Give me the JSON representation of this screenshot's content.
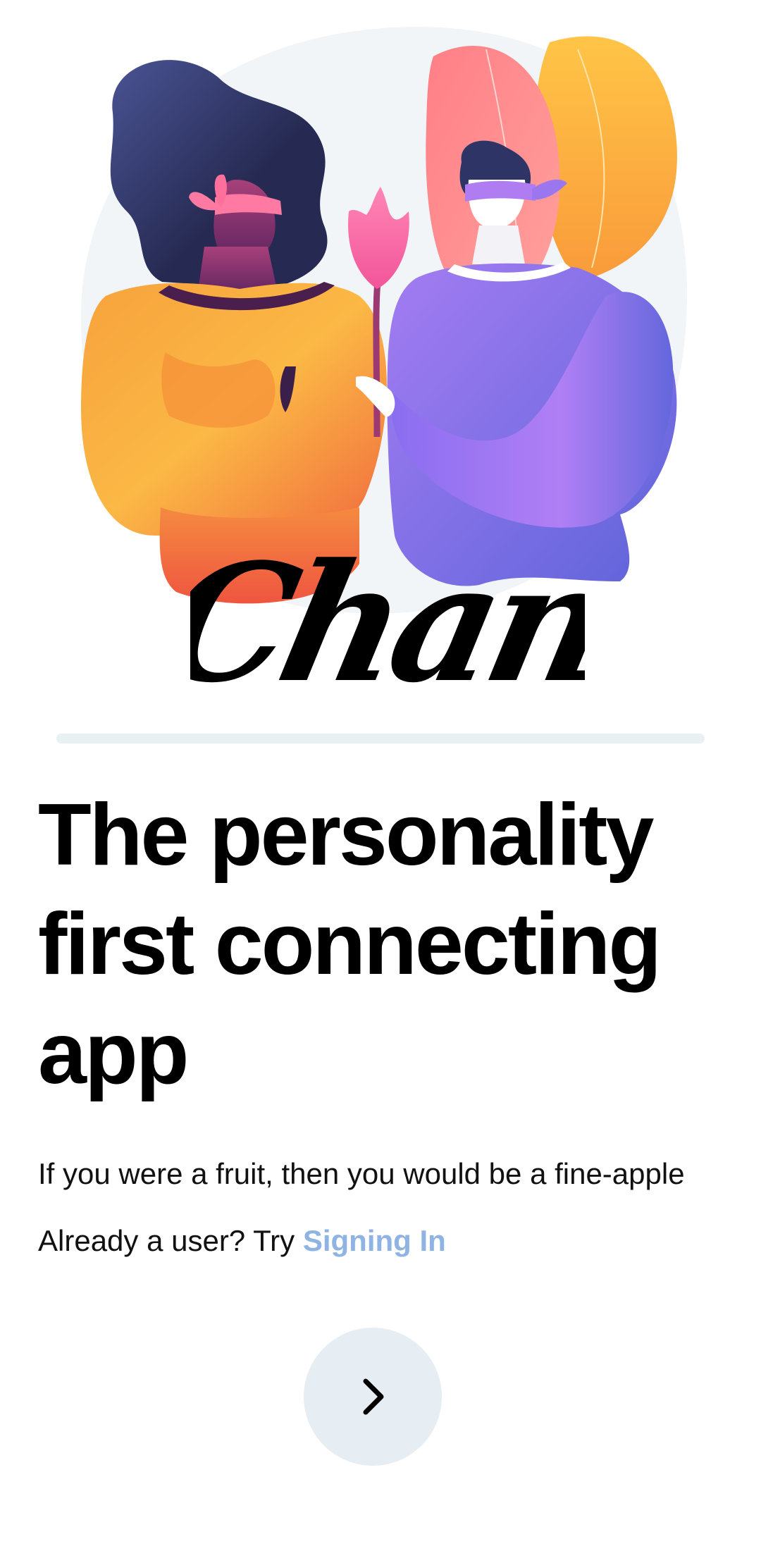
{
  "app": {
    "logo_text": "Chance"
  },
  "hero": {
    "illustration": "two-people-blindfolded-with-flower-illustration"
  },
  "headline": {
    "text": "The personality first connecting app"
  },
  "tagline": {
    "text": "If you were a fruit, then you would be a fine-apple"
  },
  "signin": {
    "prompt": "Already a user? Try ",
    "link_label": "Signing In"
  },
  "next_button": {
    "icon": "chevron-right-icon"
  },
  "colors": {
    "background": "#ffffff",
    "link": "#8fb3e3",
    "button_bg": "#e6eef3",
    "text": "#000000"
  }
}
